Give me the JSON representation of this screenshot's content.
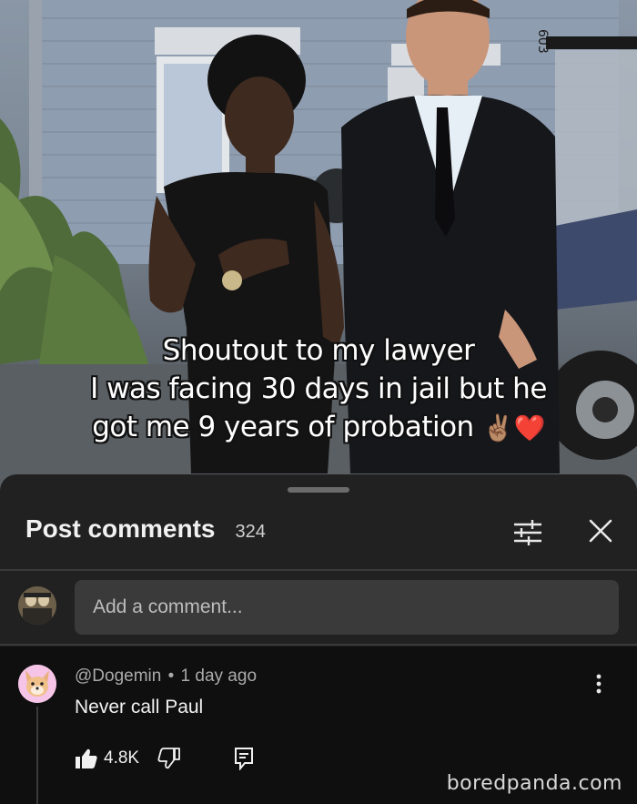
{
  "photo": {
    "caption_lines": [
      "Shoutout to my lawyer",
      "I was facing 30 days in jail but he",
      "got me 9 years of probation"
    ],
    "caption_emojis": "✌🏽❤️",
    "house_number": "603"
  },
  "sheet": {
    "title": "Post comments",
    "count": "324",
    "input_placeholder": "Add a comment..."
  },
  "comment": {
    "author": "@Dogemin",
    "separator": "•",
    "time": "1 day ago",
    "text": "Never call Paul",
    "likes": "4.8K"
  },
  "watermark": "boredpanda.com",
  "colors": {
    "sheet_bg": "#212121",
    "page_bg": "#0f0f0f",
    "input_bg": "#3a3a3a",
    "heart": "#e0262b"
  },
  "icons": [
    "filter-icon",
    "close-icon",
    "more-vertical-icon",
    "thumb-up-icon",
    "thumb-down-icon",
    "reply-icon"
  ]
}
